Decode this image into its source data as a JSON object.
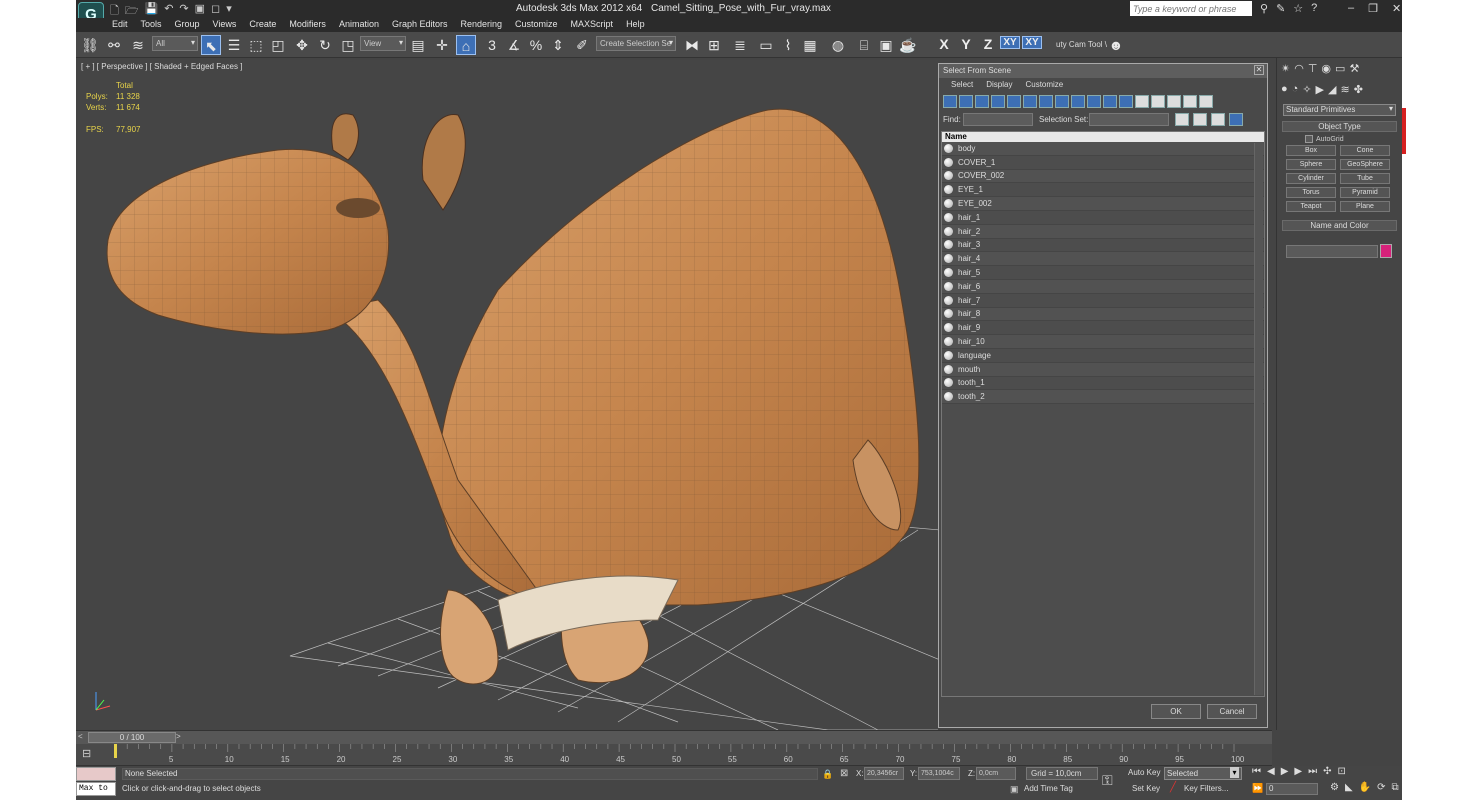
{
  "title_bar": {
    "logo": "G",
    "app": "Autodesk 3ds Max  2012 x64",
    "file": "Camel_Sitting_Pose_with_Fur_vray.max",
    "search_placeholder": "Type a keyword or phrase"
  },
  "menu": [
    "Edit",
    "Tools",
    "Group",
    "Views",
    "Create",
    "Modifiers",
    "Animation",
    "Graph Editors",
    "Rendering",
    "Customize",
    "MAXScript",
    "Help"
  ],
  "toolbar": {
    "filter": "All",
    "ref_coord": "View",
    "selection_set": "Create Selection Se",
    "axes": [
      "X",
      "Y",
      "Z",
      "XY",
      "XY"
    ],
    "cam_tool": "uty Cam Tool \\",
    "snap_labels": [
      "3",
      "%"
    ]
  },
  "viewport": {
    "label": "[ + ] [ Perspective ] [ Shaded + Edged Faces ]",
    "stats_header": "Total",
    "polys_label": "Polys:",
    "polys": "11 328",
    "verts_label": "Verts:",
    "verts": "11 674",
    "fps_label": "FPS:",
    "fps": "77,907",
    "colors": {
      "background": "#454545",
      "camel": "#c98a52",
      "grid": "#bbbbbb",
      "stats": "#e8d44a"
    }
  },
  "select_dialog": {
    "title": "Select From Scene",
    "menu": [
      "Select",
      "Display",
      "Customize"
    ],
    "find_label": "Find:",
    "selection_set_label": "Selection Set:",
    "column_header": "Name",
    "objects": [
      "body",
      "COVER_1",
      "COVER_002",
      "EYE_1",
      "EYE_002",
      "hair_1",
      "hair_2",
      "hair_3",
      "hair_4",
      "hair_5",
      "hair_6",
      "hair_7",
      "hair_8",
      "hair_9",
      "hair_10",
      "language",
      "mouth",
      "tooth_1",
      "tooth_2"
    ],
    "ok": "OK",
    "cancel": "Cancel"
  },
  "command_panel": {
    "category": "Standard Primitives",
    "object_type_header": "Object Type",
    "autogrid": "AutoGrid",
    "buttons": [
      "Box",
      "Cone",
      "Sphere",
      "GeoSphere",
      "Cylinder",
      "Tube",
      "Torus",
      "Pyramid",
      "Teapot",
      "Plane"
    ],
    "name_color_header": "Name and Color",
    "object_color": "#d6217a"
  },
  "time_slider": {
    "position": "0 / 100",
    "prev": "<",
    "next": ">",
    "ticks": [
      "5",
      "10",
      "15",
      "20",
      "25",
      "30",
      "35",
      "40",
      "45",
      "50",
      "55",
      "60",
      "65",
      "70",
      "75",
      "80",
      "85",
      "90",
      "95",
      "100"
    ]
  },
  "status": {
    "maxscript": "Max to",
    "selection": "None Selected",
    "prompt": "Click or click-and-drag to select objects",
    "x_label": "X:",
    "x": "20,3456cr",
    "y_label": "Y:",
    "y": "753,1004c",
    "z_label": "Z:",
    "z": "0,0cm",
    "grid": "Grid = 10,0cm",
    "add_time_tag": "Add Time Tag",
    "auto_key": "Auto Key",
    "set_key": "Set Key",
    "key_mode": "Selected",
    "key_filters": "Key Filters...",
    "frame": "0"
  }
}
